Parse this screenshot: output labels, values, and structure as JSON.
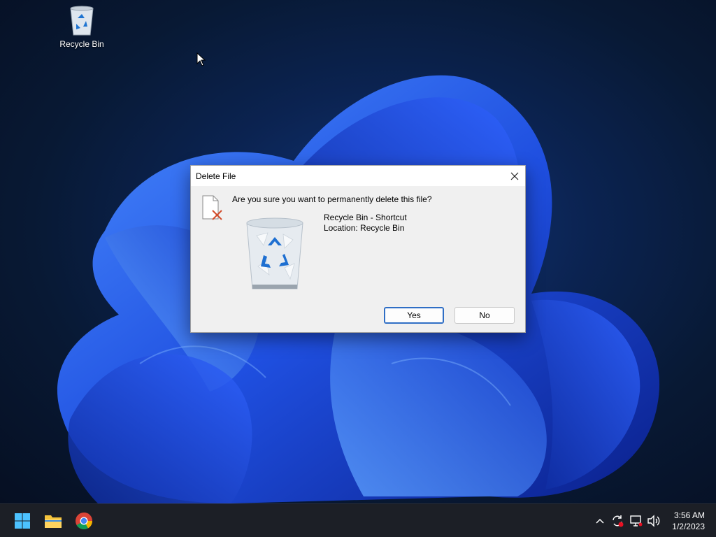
{
  "desktop": {
    "icons": [
      {
        "label": "Recycle Bin",
        "icon": "recycle-bin-icon"
      }
    ]
  },
  "dialog": {
    "title": "Delete File",
    "question": "Are you sure you want to permanently delete this file?",
    "item_name": "Recycle Bin - Shortcut",
    "item_location": "Location: Recycle Bin",
    "yes_label": "Yes",
    "no_label": "No",
    "icons": [
      "file-delete-icon",
      "recycle-bin-icon",
      "close-icon"
    ]
  },
  "taskbar": {
    "pinned": [
      "start-icon",
      "file-explorer-icon",
      "chrome-icon"
    ],
    "tray": [
      "chevron-up-icon",
      "sync-icon",
      "network-icon",
      "volume-icon"
    ],
    "time": "3:56 AM",
    "date": "1/2/2023"
  },
  "colors": {
    "accent": "#2f6ec5",
    "taskbar": "#1c1f26",
    "dialog_bg": "#f0f0f0"
  }
}
